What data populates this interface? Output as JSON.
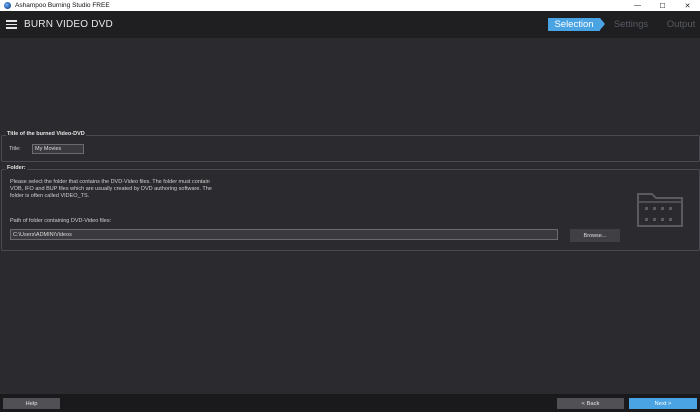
{
  "window": {
    "title": "Ashampoo Burning Studio FREE",
    "controls": {
      "minimize": "—",
      "maximize": "☐",
      "close": "✕"
    }
  },
  "header": {
    "page_title": "BURN VIDEO DVD",
    "steps": [
      "Selection",
      "Settings",
      "Output"
    ],
    "active_step": "Selection"
  },
  "title_group": {
    "legend": "Title of the burned Video-DVD",
    "label": "Title:",
    "value": "My Movies"
  },
  "folder_group": {
    "legend": "Folder:",
    "description_lines": [
      "Please select the folder that contains the DVD-Video files. The folder must contain",
      "VOB, IFO and BUP files which are usually created by DVD authoring software. The",
      "folder is often called VIDEO_TS."
    ],
    "path_label": "Path of folder containing DVD-Video files:",
    "path_value": "C:\\Users\\ADMIN\\Videos",
    "browse_label": "Browse..."
  },
  "footer": {
    "help_label": "Help",
    "back_label": "< Back",
    "next_label": "Next >"
  },
  "colors": {
    "accent": "#4aa3e3",
    "background": "#2b2b2f",
    "header": "#1f1f22"
  }
}
